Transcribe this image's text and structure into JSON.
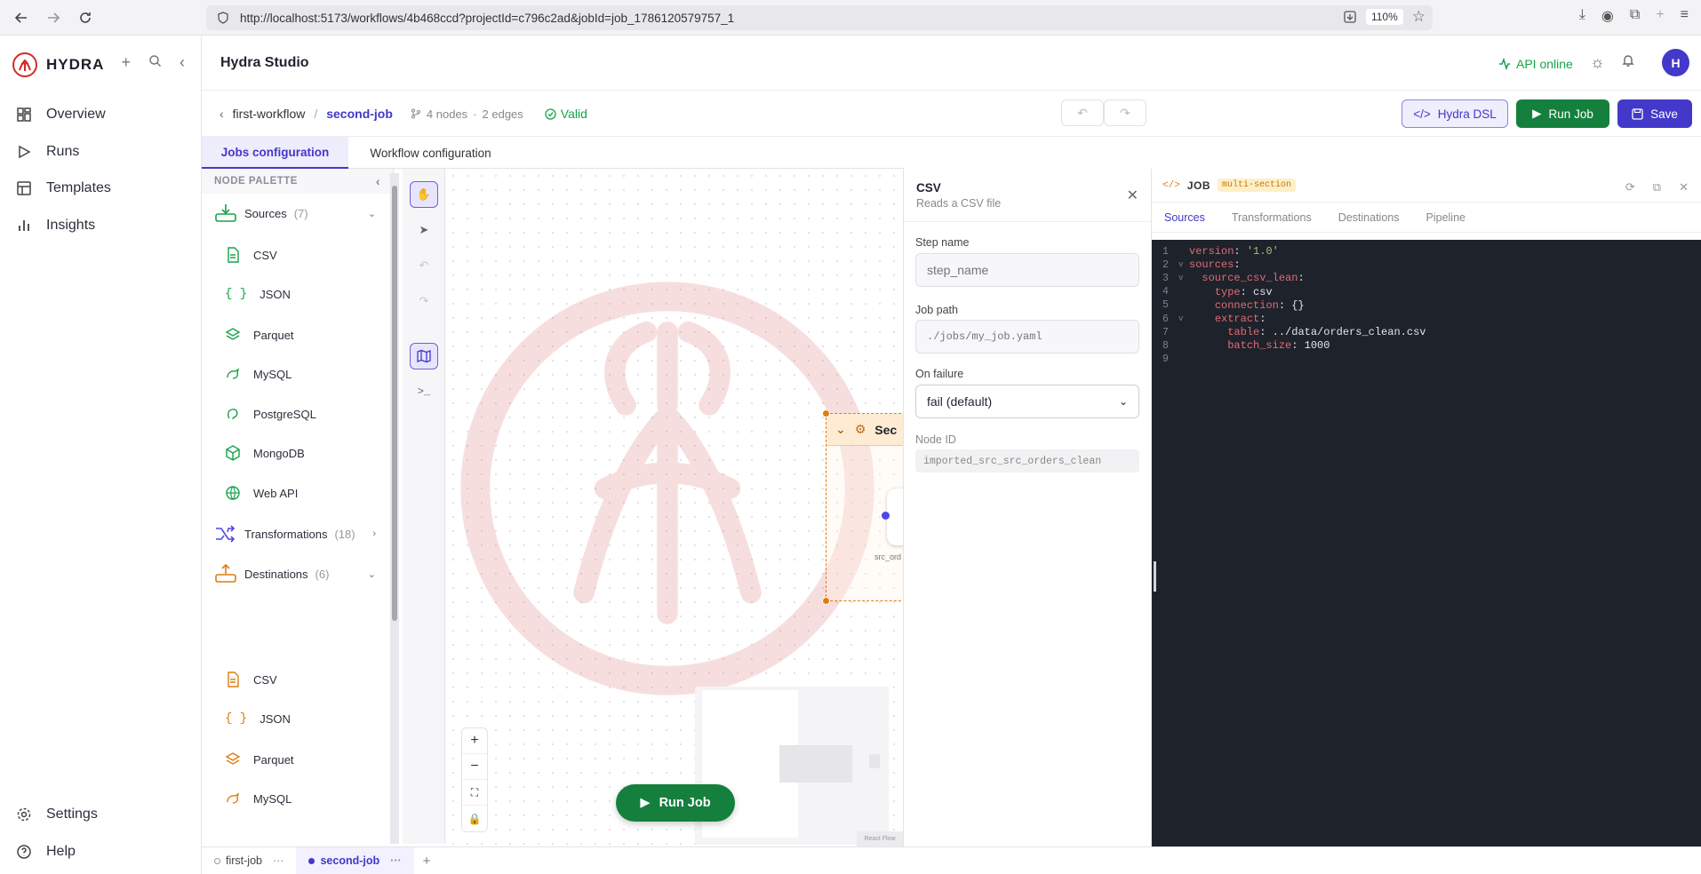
{
  "browser": {
    "url": "http://localhost:5173/workflows/4b468ccd?projectId=c796c2ad&jobId=job_1786120579757_1",
    "zoom": "110%"
  },
  "app": {
    "brand": "HYDRA",
    "title": "Hydra Studio",
    "api_status": "API online",
    "avatar_initial": "H"
  },
  "nav": {
    "items": [
      {
        "label": "Overview",
        "icon": "grid-icon"
      },
      {
        "label": "Runs",
        "icon": "play-icon"
      },
      {
        "label": "Templates",
        "icon": "layout-icon"
      },
      {
        "label": "Insights",
        "icon": "bar-chart-icon"
      }
    ],
    "settings": "Settings",
    "help": "Help"
  },
  "breadcrumb": {
    "workflow": "first-workflow",
    "separator": "/",
    "job": "second-job",
    "nodes": "4 nodes",
    "dot": "·",
    "edges": "2 edges",
    "status": "Valid"
  },
  "toolbar": {
    "dsl_label": "Hydra DSL",
    "run_label": "Run Job",
    "save_label": "Save"
  },
  "tabs": {
    "jobs": "Jobs configuration",
    "workflow": "Workflow configuration"
  },
  "palette": {
    "header": "NODE PALETTE",
    "sources": {
      "label": "Sources",
      "count": "(7)"
    },
    "source_items": [
      "CSV",
      "JSON",
      "Parquet",
      "MySQL",
      "PostgreSQL",
      "MongoDB",
      "Web API"
    ],
    "transformations": {
      "label": "Transformations",
      "count": "(18)"
    },
    "destinations": {
      "label": "Destinations",
      "count": "(6)"
    },
    "destination_items": [
      "CSV",
      "JSON",
      "Parquet",
      "MySQL"
    ]
  },
  "canvas": {
    "group_title": "Sec",
    "node_label": "src_ord",
    "run_label": "Run Job",
    "attribution": "React Flow"
  },
  "props": {
    "title": "CSV",
    "subtitle": "Reads a CSV file",
    "step_name_label": "Step name",
    "step_name_placeholder": "step_name",
    "job_path_label": "Job path",
    "job_path_placeholder": "./jobs/my_job.yaml",
    "on_failure_label": "On failure",
    "on_failure_value": "fail (default)",
    "node_id_label": "Node ID",
    "node_id_value": "imported_src_src_orders_clean"
  },
  "code": {
    "title": "JOB",
    "badge": "multi-section",
    "tabs": [
      "Sources",
      "Transformations",
      "Destinations",
      "Pipeline"
    ],
    "lines": [
      {
        "n": "1",
        "fold": "",
        "indent": "",
        "key": "version",
        "sep": ": ",
        "val": "'1.0'",
        "valtype": "s"
      },
      {
        "n": "2",
        "fold": "v",
        "indent": "",
        "key": "sources",
        "sep": ":",
        "val": "",
        "valtype": "n"
      },
      {
        "n": "3",
        "fold": "v",
        "indent": "  ",
        "key": "source_csv_lean",
        "sep": ":",
        "val": "",
        "valtype": "n"
      },
      {
        "n": "4",
        "fold": "",
        "indent": "    ",
        "key": "type",
        "sep": ": ",
        "val": "csv",
        "valtype": "n"
      },
      {
        "n": "5",
        "fold": "",
        "indent": "    ",
        "key": "connection",
        "sep": ": ",
        "val": "{}",
        "valtype": "n"
      },
      {
        "n": "6",
        "fold": "v",
        "indent": "    ",
        "key": "extract",
        "sep": ":",
        "val": "",
        "valtype": "n"
      },
      {
        "n": "7",
        "fold": "",
        "indent": "      ",
        "key": "table",
        "sep": ": ",
        "val": "../data/orders_clean.csv",
        "valtype": "n"
      },
      {
        "n": "8",
        "fold": "",
        "indent": "      ",
        "key": "batch_size",
        "sep": ": ",
        "val": "1000",
        "valtype": "n"
      },
      {
        "n": "9",
        "fold": "",
        "indent": "",
        "key": "",
        "sep": "",
        "val": "",
        "valtype": "n"
      }
    ]
  },
  "job_tabs": [
    "first-job",
    "second-job"
  ],
  "colors": {
    "accent": "#4338ca",
    "success": "#15803d",
    "warning": "#e07b12"
  }
}
